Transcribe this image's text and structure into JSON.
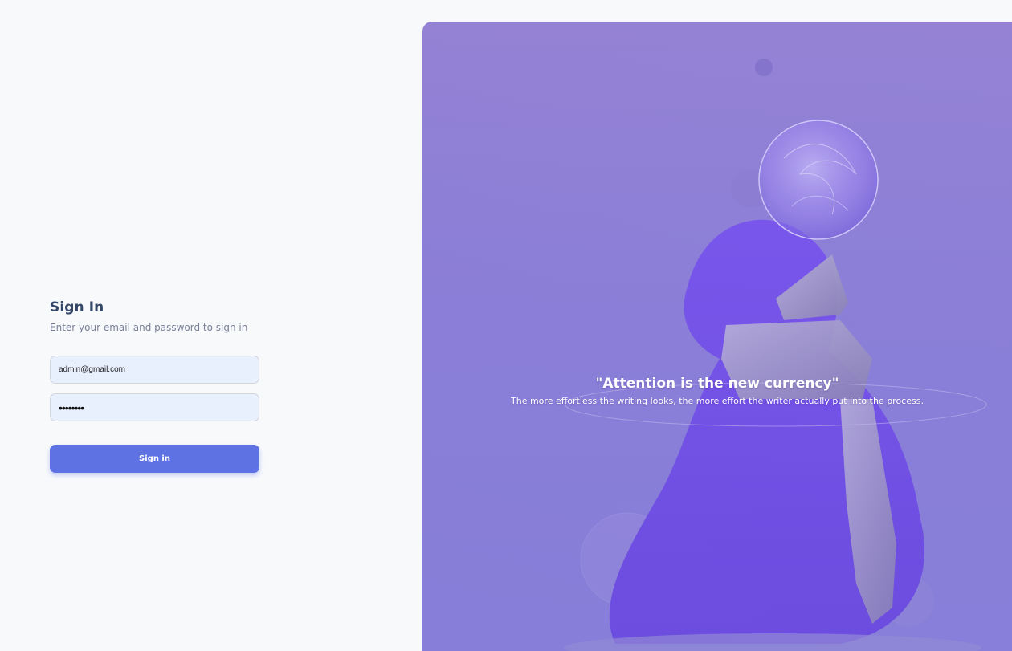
{
  "signin": {
    "title": "Sign In",
    "subtitle": "Enter your email and password to sign in",
    "email_value": "admin@gmail.com",
    "password_value": "••••••••",
    "button_label": "Sign in"
  },
  "hero": {
    "quote": "\"Attention is the new currency\"",
    "subtext": "The more effortless the writing looks, the more effort the writer actually put into the process."
  },
  "colors": {
    "primary": "#5e72e4",
    "title": "#344767",
    "muted": "#7b809a",
    "input_bg": "#e8f0fe",
    "panel_bg": "#9184d8"
  }
}
